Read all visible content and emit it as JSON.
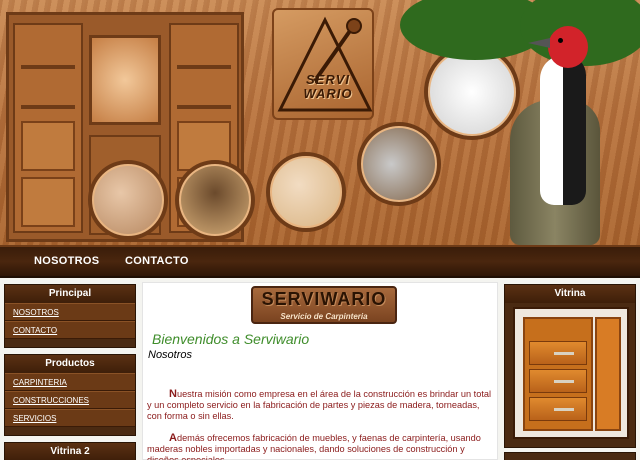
{
  "banner": {
    "logo_line1": "SERVI",
    "logo_line2": "WARIO"
  },
  "topnav": [
    {
      "label": "NOSOTROS"
    },
    {
      "label": "CONTACTO"
    }
  ],
  "sidebar_left": {
    "principal": {
      "title": "Principal",
      "items": [
        {
          "label": "NOSOTROS"
        },
        {
          "label": "CONTACTO"
        }
      ]
    },
    "productos": {
      "title": "Productos",
      "items": [
        {
          "label": "CARPINTERIA"
        },
        {
          "label": "CONSTRUCCIONES"
        },
        {
          "label": "SERVICIOS"
        }
      ]
    },
    "vitrina2": {
      "title": "Vitrina 2"
    }
  },
  "sidebar_right": {
    "vitrina": {
      "title": "Vitrina"
    }
  },
  "main": {
    "plaque_title": "SERVIWARIO",
    "plaque_subtitle": "Servicio de Carpinteria",
    "welcome": "Bienvenidos a Serviwario",
    "subheading": "Nosotros",
    "p1_initial": "N",
    "p1_text": "uestra misión como empresa en el área de la construcción es brindar un total y un completo servicio en la fabricación de partes y piezas de madera, torneadas, con forma o sin ellas.",
    "p2_initial": "A",
    "p2_text": "demás ofrecemos fabricación de muebles, y faenas de carpintería, usando maderas nobles importadas y nacionales, dando soluciones de construcción y diseños especiales."
  },
  "colors": {
    "nav_bg": "#3a1d0a",
    "welcome_green": "#3f8d2b",
    "body_red": "#8a1a1a"
  }
}
